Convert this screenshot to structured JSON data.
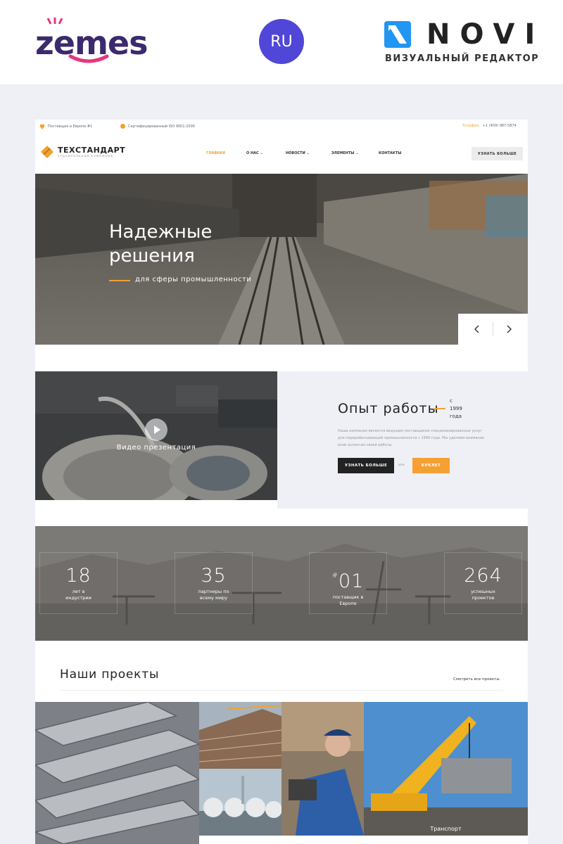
{
  "promo": {
    "zemes_logo": "zemes",
    "language_badge": "RU",
    "novi_logo": "NOVI",
    "novi_subtitle": "ВИЗУАЛЬНЫЙ РЕДАКТОР",
    "colors": {
      "zemes": "#3b2a6e",
      "zemes_accent": "#e8357b",
      "badge": "#5046d8",
      "novi_accent": "#2196f3"
    }
  },
  "topbar": {
    "supplier_text": "Поставщик в Европе #1",
    "certified_text": "Сертифицированный ISO 9001:2000",
    "phone_label": "Телефон:",
    "phone_value": "+1 (409) 987-5874"
  },
  "navbar": {
    "brand_title": "ТЕХСТАНДАРТ",
    "brand_subtitle": "строительная компания",
    "menu": [
      "ГЛАВНАЯ",
      "О НАС",
      "НОВОСТИ",
      "ЭЛЕМЕНТЫ",
      "КОНТАКТЫ"
    ],
    "cta": "УЗНАТЬ БОЛЬШЕ"
  },
  "hero": {
    "title_line1": "Надежные",
    "title_line2": "решения",
    "subtitle": "для сферы промышленности",
    "prev_icon": "chevron-left-icon",
    "next_icon": "chevron-right-icon"
  },
  "video": {
    "label": "Видео презентация",
    "play_icon": "play-icon"
  },
  "experience": {
    "title": "Опыт работы",
    "since_line1": "с",
    "since_line2": "1999",
    "since_line3": "года",
    "text": "Наша компания является ведущим поставщиком специализированных услуг для перерабатывающей промышленности с 1999 года. Мы уделяем внимание всем аспектам своей работы.",
    "primary_button": "УЗНАТЬ БОЛЬШЕ",
    "or": "или",
    "secondary_button": "БУКЛЕТ"
  },
  "stats": [
    {
      "prefix": "",
      "value": "18",
      "label_line1": "лет в",
      "label_line2": "индустрии"
    },
    {
      "prefix": "",
      "value": "35",
      "label_line1": "партнеры по",
      "label_line2": "всему миру"
    },
    {
      "prefix": "#",
      "value": "01",
      "label_line1": "поставщик в",
      "label_line2": "Европе"
    },
    {
      "prefix": "",
      "value": "264",
      "label_line1": "успешных",
      "label_line2": "проектов"
    }
  ],
  "projects": {
    "title": "Наши проекты",
    "view_all": "Смотреть все проекты",
    "transport_label": "Транспорт"
  },
  "accent_color": "#f0a22e"
}
